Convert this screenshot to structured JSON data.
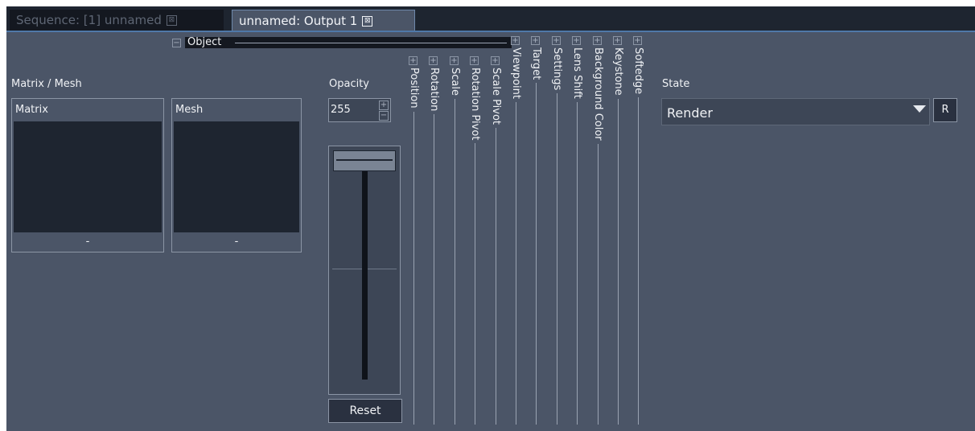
{
  "tabs": [
    {
      "label": "Sequence: [1] unnamed",
      "close": "⊠"
    },
    {
      "label": "unnamed: Output 1",
      "close": "⊠"
    }
  ],
  "object": {
    "toggle": "−",
    "label": "Object"
  },
  "matrix_mesh": {
    "title": "Matrix / Mesh",
    "matrix": {
      "header": "Matrix",
      "value": "-"
    },
    "mesh": {
      "header": "Mesh",
      "value": "-"
    }
  },
  "opacity": {
    "label": "Opacity",
    "value": "255",
    "max": 255,
    "up": "+",
    "down": "−",
    "reset_label": "Reset"
  },
  "columns": [
    {
      "label": "Position",
      "toggle": "+"
    },
    {
      "label": "Rotation",
      "toggle": "+"
    },
    {
      "label": "Scale",
      "toggle": "+"
    },
    {
      "label": "Rotation Pivot",
      "toggle": "+"
    },
    {
      "label": "Scale Pivot",
      "toggle": "+"
    },
    {
      "label": "Viewpoint",
      "toggle": "+"
    },
    {
      "label": "Target",
      "toggle": "+"
    },
    {
      "label": "Settings",
      "toggle": "+"
    },
    {
      "label": "Lens Shift",
      "toggle": "+"
    },
    {
      "label": "Background Color",
      "toggle": "+"
    },
    {
      "label": "Keystone",
      "toggle": "+"
    },
    {
      "label": "Softedge",
      "toggle": "+"
    }
  ],
  "state": {
    "label": "State",
    "value": "Render",
    "reset_label": "R"
  }
}
